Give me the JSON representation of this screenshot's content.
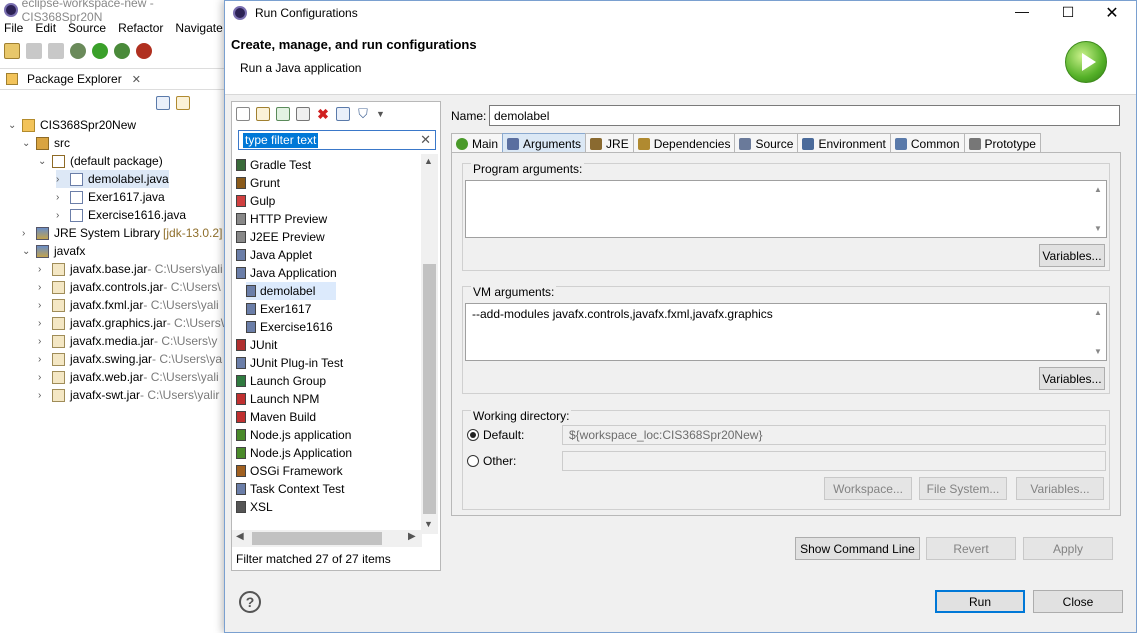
{
  "background_window": {
    "title": "eclipse-workspace-new - CIS368Spr20N",
    "menu": [
      "File",
      "Edit",
      "Source",
      "Refactor",
      "Navigate"
    ],
    "view_tab": "Package Explorer",
    "tree": [
      {
        "label": "CIS368Spr20New",
        "suffix": "",
        "icon": "project-icon",
        "chev": "v"
      },
      {
        "label": "src",
        "suffix": "",
        "icon": "source-folder-icon",
        "chev": "v"
      },
      {
        "label": "(default package)",
        "suffix": "",
        "icon": "package-icon",
        "chev": "v"
      },
      {
        "label": "demolabel.java",
        "suffix": "",
        "icon": "java-file-icon",
        "chev": ">"
      },
      {
        "label": "Exer1617.java",
        "suffix": "",
        "icon": "java-file-icon",
        "chev": ">"
      },
      {
        "label": "Exercise1616.java",
        "suffix": "",
        "icon": "java-file-icon",
        "chev": ">"
      },
      {
        "label": "JRE System Library",
        "suffix": "[jdk-13.0.2]",
        "icon": "library-icon",
        "chev": ">"
      },
      {
        "label": "javafx",
        "suffix": "",
        "icon": "library-icon",
        "chev": "v"
      },
      {
        "label": "javafx.base.jar",
        "suffix": " - C:\\Users\\yali",
        "icon": "jar-icon",
        "chev": ">"
      },
      {
        "label": "javafx.controls.jar",
        "suffix": " - C:\\Users\\",
        "icon": "jar-icon",
        "chev": ">"
      },
      {
        "label": "javafx.fxml.jar",
        "suffix": " - C:\\Users\\yali",
        "icon": "jar-icon",
        "chev": ">"
      },
      {
        "label": "javafx.graphics.jar",
        "suffix": " - C:\\Users\\",
        "icon": "jar-icon",
        "chev": ">"
      },
      {
        "label": "javafx.media.jar",
        "suffix": " - C:\\Users\\y",
        "icon": "jar-icon",
        "chev": ">"
      },
      {
        "label": "javafx.swing.jar",
        "suffix": " - C:\\Users\\ya",
        "icon": "jar-icon",
        "chev": ">"
      },
      {
        "label": "javafx.web.jar",
        "suffix": " - C:\\Users\\yali",
        "icon": "jar-icon",
        "chev": ">"
      },
      {
        "label": "javafx-swt.jar",
        "suffix": " - C:\\Users\\yalir",
        "icon": "jar-icon",
        "chev": ">"
      }
    ]
  },
  "dialog": {
    "title": "Run Configurations",
    "heading": "Create, manage, and run configurations",
    "subheading": "Run a Java application",
    "filter_placeholder": "type filter text",
    "configs": [
      {
        "label": "Gradle Test",
        "indent": 0,
        "color": "#3a6b3a"
      },
      {
        "label": "Grunt",
        "indent": 0,
        "color": "#8a5a1a"
      },
      {
        "label": "Gulp",
        "indent": 0,
        "color": "#d04040"
      },
      {
        "label": "HTTP Preview",
        "indent": 0,
        "color": "#888888"
      },
      {
        "label": "J2EE Preview",
        "indent": 0,
        "color": "#888888"
      },
      {
        "label": "Java Applet",
        "indent": 0,
        "color": "#6b7ea8"
      },
      {
        "label": "Java Application",
        "indent": 0,
        "color": "#6b7ea8"
      },
      {
        "label": "demolabel",
        "indent": 1,
        "color": "#6b7ea8"
      },
      {
        "label": "Exer1617",
        "indent": 1,
        "color": "#6b7ea8"
      },
      {
        "label": "Exercise1616",
        "indent": 1,
        "color": "#6b7ea8"
      },
      {
        "label": "JUnit",
        "indent": 0,
        "color": "#b03030"
      },
      {
        "label": "JUnit Plug-in Test",
        "indent": 0,
        "color": "#6b7ea8"
      },
      {
        "label": "Launch Group",
        "indent": 0,
        "color": "#2f7a3f"
      },
      {
        "label": "Launch NPM",
        "indent": 0,
        "color": "#c03030"
      },
      {
        "label": "Maven Build",
        "indent": 0,
        "color": "#c03030"
      },
      {
        "label": "Node.js application",
        "indent": 0,
        "color": "#4a8a2a"
      },
      {
        "label": "Node.js Application",
        "indent": 0,
        "color": "#4a8a2a"
      },
      {
        "label": "OSGi Framework",
        "indent": 0,
        "color": "#a06020"
      },
      {
        "label": "Task Context Test",
        "indent": 0,
        "color": "#6b7ea8"
      },
      {
        "label": "XSL",
        "indent": 0,
        "color": "#555555"
      }
    ],
    "selected_config": "demolabel",
    "filter_status": "Filter matched 27 of 27 items",
    "name_label": "Name:",
    "name_value": "demolabel",
    "tabs": [
      {
        "label": "Main",
        "icon": "main-tab-icon",
        "color": "#4a9a2a",
        "active": false
      },
      {
        "label": "Arguments",
        "icon": "arguments-tab-icon",
        "color": "#5a6fa0",
        "active": true
      },
      {
        "label": "JRE",
        "icon": "jre-tab-icon",
        "color": "#8a6a30",
        "active": false
      },
      {
        "label": "Dependencies",
        "icon": "dependencies-tab-icon",
        "color": "#b08a30",
        "active": false
      },
      {
        "label": "Source",
        "icon": "source-tab-icon",
        "color": "#6a7a9a",
        "active": false
      },
      {
        "label": "Environment",
        "icon": "environment-tab-icon",
        "color": "#4a6a9a",
        "active": false
      },
      {
        "label": "Common",
        "icon": "common-tab-icon",
        "color": "#5a7aaa",
        "active": false
      },
      {
        "label": "Prototype",
        "icon": "prototype-tab-icon",
        "color": "#777777",
        "active": false
      }
    ],
    "program_args_label": "Program arguments:",
    "program_args_value": "",
    "vm_args_label": "VM arguments:",
    "vm_args_value": "--add-modules javafx.controls,javafx.fxml,javafx.graphics",
    "variables_label": "Variables...",
    "working_dir_label": "Working directory:",
    "default_label": "Default:",
    "default_value": "${workspace_loc:CIS368Spr20New}",
    "other_label": "Other:",
    "other_value": "",
    "workspace_btn": "Workspace...",
    "filesystem_btn": "File System...",
    "variables_btn2": "Variables...",
    "show_cmd_btn": "Show Command Line",
    "revert_btn": "Revert",
    "apply_btn": "Apply",
    "run_btn": "Run",
    "close_btn": "Close",
    "help_glyph": "?"
  }
}
